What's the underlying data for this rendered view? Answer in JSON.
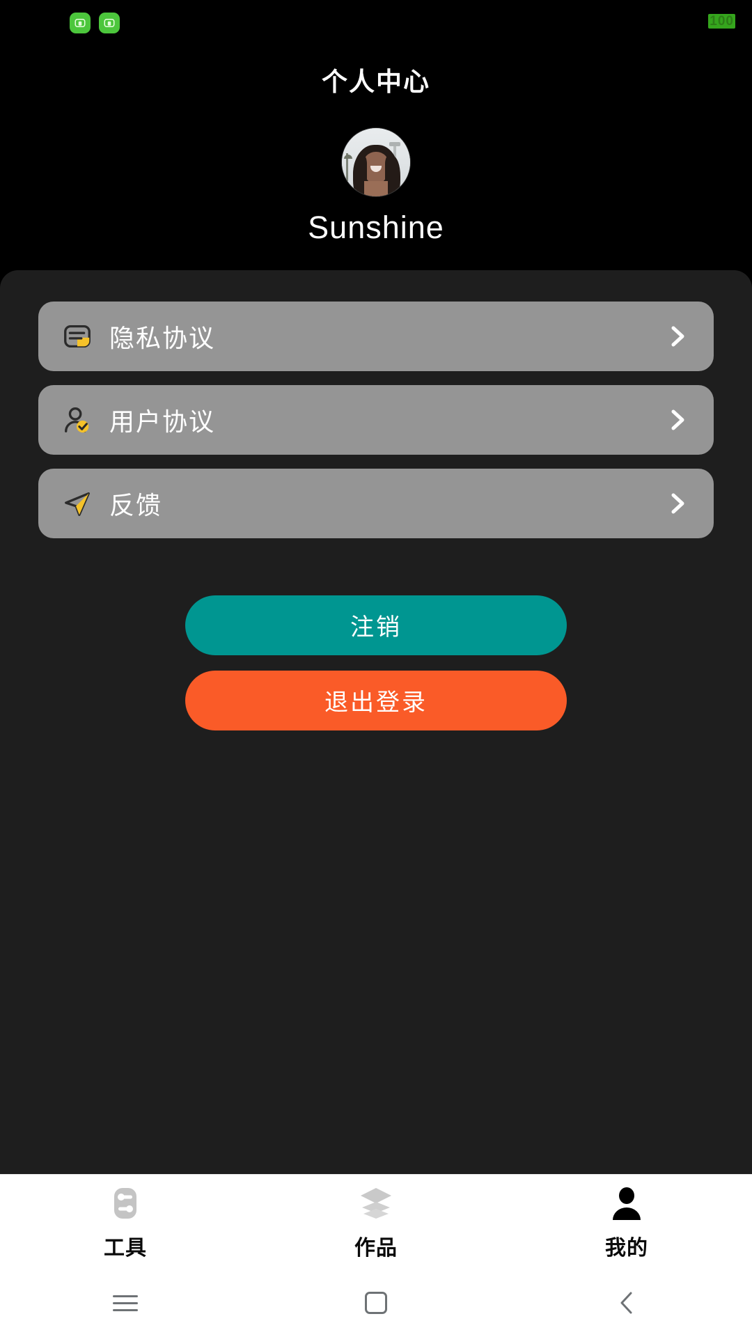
{
  "status_bar": {
    "left_icons": [
      {
        "name": "notification-app-icon-1",
        "glyph": "chat-bubble",
        "color": "#4cc63c"
      },
      {
        "name": "notification-app-icon-2",
        "glyph": "chat-bubble",
        "color": "#4cc63c"
      }
    ],
    "battery_level": "100",
    "battery_color": "#35a51d"
  },
  "header": {
    "title": "个人中心"
  },
  "profile": {
    "avatar_alt": "woman smiling outdoors with palm trees",
    "username": "Sunshine"
  },
  "menu": {
    "items": [
      {
        "label": "隐私协议",
        "icon": "document-note-icon",
        "accent": "#f5c22a",
        "chevron": "chevron-right-icon"
      },
      {
        "label": "用户协议",
        "icon": "user-check-icon",
        "accent": "#f5c22a",
        "chevron": "chevron-right-icon"
      },
      {
        "label": "反馈",
        "icon": "send-plane-icon",
        "accent": "#f5c22a",
        "chevron": "chevron-right-icon"
      }
    ],
    "row_color": "#959595",
    "panel_color": "#1e1e1e"
  },
  "actions": {
    "logoff_label": "注销",
    "logoff_color": "#009691",
    "exit_label": "退出登录",
    "exit_color": "#fa5b28"
  },
  "tabbar": {
    "tabs": [
      {
        "label": "工具",
        "icon": "sliders-icon",
        "active": "false"
      },
      {
        "label": "作品",
        "icon": "layers-icon",
        "active": "false"
      },
      {
        "label": "我的",
        "icon": "person-icon",
        "active": "true"
      }
    ]
  },
  "navbar": {
    "buttons": [
      {
        "name": "recents-button",
        "icon": "menu-lines-icon"
      },
      {
        "name": "home-button",
        "icon": "square-icon"
      },
      {
        "name": "back-button",
        "icon": "chevron-left-icon"
      }
    ]
  }
}
